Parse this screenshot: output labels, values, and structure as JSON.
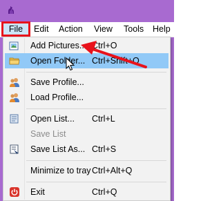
{
  "menubar": {
    "items": [
      {
        "label": "File"
      },
      {
        "label": "Edit"
      },
      {
        "label": "Action"
      },
      {
        "label": "View"
      },
      {
        "label": "Tools"
      },
      {
        "label": "Help"
      }
    ]
  },
  "file_menu": {
    "items": [
      {
        "label": "Add Pictures...",
        "shortcut": "Ctrl+O",
        "icon": "add-pictures-icon"
      },
      {
        "label": "Open Folder...",
        "shortcut": "Ctrl+Shift+O",
        "icon": "folder-icon"
      },
      {
        "label": "Save Profile...",
        "shortcut": "",
        "icon": "users-icon"
      },
      {
        "label": "Load Profile...",
        "shortcut": "",
        "icon": "users-icon"
      },
      {
        "label": "Open List...",
        "shortcut": "Ctrl+L",
        "icon": "open-list-icon"
      },
      {
        "label": "Save List",
        "shortcut": "",
        "icon": "",
        "disabled": true
      },
      {
        "label": "Save List As...",
        "shortcut": "Ctrl+S",
        "icon": "save-list-icon"
      },
      {
        "label": "Minimize to tray",
        "shortcut": "Ctrl+Alt+Q",
        "icon": ""
      },
      {
        "label": "Exit",
        "shortcut": "Ctrl+Q",
        "icon": "power-icon"
      }
    ]
  },
  "colors": {
    "titlebar": "#a86ad0",
    "menu_hover": "#91c9f7",
    "annotation": "#e8121b",
    "menu_background": "#f2f2f2"
  }
}
